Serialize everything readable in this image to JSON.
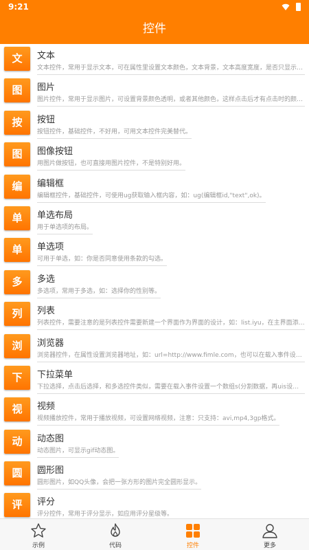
{
  "status": {
    "time": "9:21"
  },
  "header": {
    "title": "控件"
  },
  "items": [
    {
      "badge": "文",
      "title": "文本",
      "desc": "文本控件，常用于显示文本，可在属性里设置文本颜色，文本背景，文本高度宽度，是否只显示同一行，..."
    },
    {
      "badge": "图",
      "title": "图片",
      "desc": "图片控件，常用于显示图片，可设置背景颜色透明，或者其他颜色，这样点击后才有点击时的颜色，注意..."
    },
    {
      "badge": "按",
      "title": "按钮",
      "desc": "按钮控件，基础控件，不好用，可用文本控件完美替代。"
    },
    {
      "badge": "图",
      "title": "图像按钮",
      "desc": "用图片做按钮，也可直接用图片控件，不是特别好用。"
    },
    {
      "badge": "编",
      "title": "编辑框",
      "desc": "编辑框控件，基础控件，可使用ug获取输入框内容，如：ug(编辑框id,\"text\",ok)。"
    },
    {
      "badge": "单",
      "title": "单选布局",
      "desc": "用于单选项的布局。"
    },
    {
      "badge": "单",
      "title": "单选项",
      "desc": "可用于单选，如：你是否同意使用条款的勾选。"
    },
    {
      "badge": "多",
      "title": "多选",
      "desc": "多选项，常用于多选，如：选择你的性别等。"
    },
    {
      "badge": "列",
      "title": "列表",
      "desc": "列表控件，需要注意的是列表控件需要新建一个界面作为界面的设计，如：list.iyu，在主界面添加列表控..."
    },
    {
      "badge": "浏",
      "title": "浏览器",
      "desc": "浏览器控件，在属性设置浏览器地址，如：url=http://www.fimle.com，也可以在载入事件设置us(浏览器..."
    },
    {
      "badge": "下",
      "title": "下拉菜单",
      "desc": "下拉选择，点击后选择，和多选控件类似，需要在载入事件设置一个数组s(分割数据，再uis设置到下拉控..."
    },
    {
      "badge": "视",
      "title": "视频",
      "desc": "视频播放控件，常用于播放视频，可设置网络视频，注意：只支持：avi,mp4,3gp格式。"
    },
    {
      "badge": "动",
      "title": "动态图",
      "desc": "动态图片，可显示gif动态图。"
    },
    {
      "badge": "圆",
      "title": "圆形图",
      "desc": "圆形图片，如QQ头像，会把一张方形的图片完全圆形显示。"
    },
    {
      "badge": "评",
      "title": "评分",
      "desc": "评分控件，常用于评分显示，如应用评分星级等。"
    }
  ],
  "tabs": [
    {
      "label": "示例",
      "icon": "star-icon"
    },
    {
      "label": "代码",
      "icon": "flame-icon"
    },
    {
      "label": "控件",
      "icon": "grid-icon"
    },
    {
      "label": "更多",
      "icon": "person-icon"
    }
  ],
  "colors": {
    "accent": "#FF7F00",
    "badge_top": "#FF9A1E",
    "badge_bottom": "#FF7400"
  }
}
